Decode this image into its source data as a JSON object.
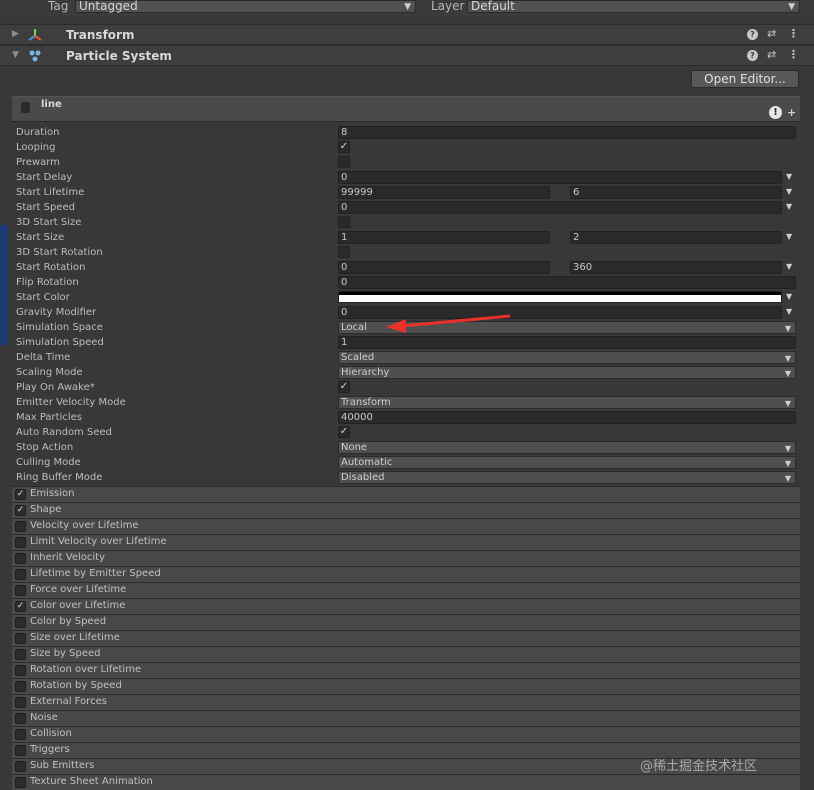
{
  "top": {
    "tag_label": "Tag",
    "tag_value": "Untagged",
    "layer_label": "Layer",
    "layer_value": "Default"
  },
  "components": {
    "transform": {
      "title": "Transform",
      "icon": "transform-gizmo-icon"
    },
    "particle_system": {
      "title": "Particle System",
      "icon": "particle-system-icon"
    }
  },
  "open_editor_label": "Open Editor...",
  "system_name": "line",
  "properties": [
    {
      "label": "Duration",
      "type": "field",
      "value": "8"
    },
    {
      "label": "Looping",
      "type": "check",
      "value": "✓"
    },
    {
      "label": "Prewarm",
      "type": "check",
      "value": ""
    },
    {
      "label": "Start Delay",
      "type": "field-arrow",
      "value": "0"
    },
    {
      "label": "Start Lifetime",
      "type": "range",
      "value": "99999",
      "value2": "6"
    },
    {
      "label": "Start Speed",
      "type": "field-arrow",
      "value": "0"
    },
    {
      "label": "3D Start Size",
      "type": "check",
      "value": ""
    },
    {
      "label": "Start Size",
      "type": "range",
      "value": "1",
      "value2": "2"
    },
    {
      "label": "3D Start Rotation",
      "type": "check",
      "value": ""
    },
    {
      "label": "Start Rotation",
      "type": "range",
      "value": "0",
      "value2": "360"
    },
    {
      "label": "Flip Rotation",
      "type": "field",
      "value": "0"
    },
    {
      "label": "Start Color",
      "type": "color",
      "value": ""
    },
    {
      "label": "Gravity Modifier",
      "type": "field-arrow",
      "value": "0"
    },
    {
      "label": "Simulation Space",
      "type": "dropdown",
      "value": "Local"
    },
    {
      "label": "Simulation Speed",
      "type": "field",
      "value": "1"
    },
    {
      "label": "Delta Time",
      "type": "dropdown",
      "value": "Scaled"
    },
    {
      "label": "Scaling Mode",
      "type": "dropdown",
      "value": "Hierarchy"
    },
    {
      "label": "Play On Awake*",
      "type": "check",
      "value": "✓"
    },
    {
      "label": "Emitter Velocity Mode",
      "type": "dropdown",
      "value": "Transform"
    },
    {
      "label": "Max Particles",
      "type": "field",
      "value": "40000"
    },
    {
      "label": "Auto Random Seed",
      "type": "check",
      "value": "✓"
    },
    {
      "label": "Stop Action",
      "type": "dropdown",
      "value": "None"
    },
    {
      "label": "Culling Mode",
      "type": "dropdown",
      "value": "Automatic"
    },
    {
      "label": "Ring Buffer Mode",
      "type": "dropdown",
      "value": "Disabled"
    }
  ],
  "modules": [
    {
      "label": "Emission",
      "checked": "✓"
    },
    {
      "label": "Shape",
      "checked": "✓"
    },
    {
      "label": "Velocity over Lifetime",
      "checked": ""
    },
    {
      "label": "Limit Velocity over Lifetime",
      "checked": ""
    },
    {
      "label": "Inherit Velocity",
      "checked": ""
    },
    {
      "label": "Lifetime by Emitter Speed",
      "checked": ""
    },
    {
      "label": "Force over Lifetime",
      "checked": ""
    },
    {
      "label": "Color over Lifetime",
      "checked": "✓"
    },
    {
      "label": "Color by Speed",
      "checked": ""
    },
    {
      "label": "Size over Lifetime",
      "checked": ""
    },
    {
      "label": "Size by Speed",
      "checked": ""
    },
    {
      "label": "Rotation over Lifetime",
      "checked": ""
    },
    {
      "label": "Rotation by Speed",
      "checked": ""
    },
    {
      "label": "External Forces",
      "checked": ""
    },
    {
      "label": "Noise",
      "checked": ""
    },
    {
      "label": "Collision",
      "checked": ""
    },
    {
      "label": "Triggers",
      "checked": ""
    },
    {
      "label": "Sub Emitters",
      "checked": ""
    },
    {
      "label": "Texture Sheet Animation",
      "checked": ""
    }
  ],
  "watermark": "@稀土掘金技术社区",
  "colors": {
    "annotation_arrow": "#e8322b",
    "start_color": "#ffffff"
  }
}
